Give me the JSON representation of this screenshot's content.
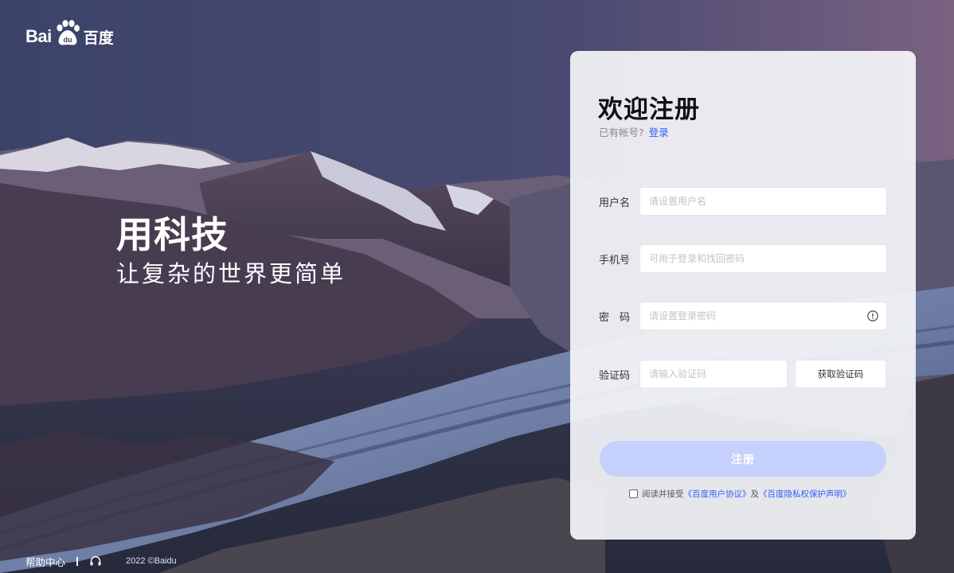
{
  "brand": {
    "logo_latin": "Bai",
    "logo_du": "du",
    "logo_cn": "百度"
  },
  "slogan": {
    "title": "用科技",
    "subtitle": "让复杂的世界更简单"
  },
  "footer": {
    "help_center": "帮助中心",
    "copyright": "2022 ©Baidu"
  },
  "register": {
    "title": "欢迎注册",
    "have_account": "已有帐号?",
    "login_link": "登录",
    "fields": {
      "username": {
        "label": "用户名",
        "placeholder": "请设置用户名",
        "value": ""
      },
      "phone": {
        "label": "手机号",
        "placeholder": "可用于登录和找回密码",
        "value": ""
      },
      "password": {
        "label": "密　码",
        "placeholder": "请设置登录密码",
        "value": ""
      },
      "code": {
        "label": "验证码",
        "placeholder": "请输入验证码",
        "value": ""
      }
    },
    "get_code_button": "获取验证码",
    "submit_button": "注册",
    "agreement": {
      "prefix": "阅读并接受",
      "user_agreement": "《百度用户协议》",
      "conjunction": "及",
      "privacy_policy": "《百度隐私权保护声明》",
      "checked": false
    }
  },
  "colors": {
    "accent": "#315efb",
    "submit_disabled": "#c5d1fc",
    "card_bg": "#f4f5f9"
  },
  "icons": {
    "logo": "baidu-paw-icon",
    "password_toggle": "eye-icon",
    "footer": "headset-icon"
  }
}
